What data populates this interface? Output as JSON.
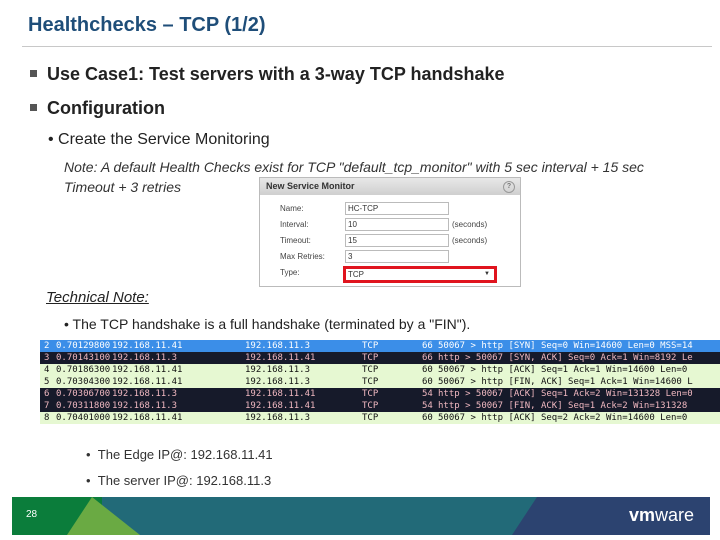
{
  "title": "Healthchecks – TCP (1/2)",
  "bullets": [
    "Use Case1: Test servers with a 3-way TCP handshake",
    "Configuration"
  ],
  "sub_bullet": "Create the Service Monitoring",
  "note": "Note: A default Health Checks exist for TCP \"default_tcp_monitor\" with 5 sec interval + 15 sec Timeout + 3 retries",
  "dialog": {
    "title": "New Service Monitor",
    "help": "?",
    "fields": [
      {
        "label": "Name:",
        "value": "HC-TCP",
        "unit": ""
      },
      {
        "label": "Interval:",
        "value": "10",
        "unit": "(seconds)"
      },
      {
        "label": "Timeout:",
        "value": "15",
        "unit": "(seconds)"
      },
      {
        "label": "Max Retries:",
        "value": "3",
        "unit": ""
      },
      {
        "label": "Type:",
        "value": "TCP",
        "unit": ""
      }
    ]
  },
  "technical_note": "Technical Note:",
  "technical_bullet": "The TCP handshake is a full handshake (terminated by a \"FIN\").",
  "packets": [
    {
      "no": "2",
      "time": "0.70129800",
      "src": "192.168.11.41",
      "dst": "192.168.11.3",
      "proto": "TCP",
      "len": "66",
      "info": "50067 > http [SYN] Seq=0 Win=14600 Len=0 MSS=14",
      "style": "blue"
    },
    {
      "no": "3",
      "time": "0.70143100",
      "src": "192.168.11.3",
      "dst": "192.168.11.41",
      "proto": "TCP",
      "len": "66",
      "info": "http > 50067 [SYN, ACK] Seq=0 Ack=1 Win=8192 Le",
      "style": "dark"
    },
    {
      "no": "4",
      "time": "0.70186300",
      "src": "192.168.11.41",
      "dst": "192.168.11.3",
      "proto": "TCP",
      "len": "60",
      "info": "50067 > http [ACK] Seq=1 Ack=1 Win=14600 Len=0",
      "style": "green"
    },
    {
      "no": "5",
      "time": "0.70304300",
      "src": "192.168.11.41",
      "dst": "192.168.11.3",
      "proto": "TCP",
      "len": "60",
      "info": "50067 > http [FIN, ACK] Seq=1 Ack=1 Win=14600 L",
      "style": "green"
    },
    {
      "no": "6",
      "time": "0.70306700",
      "src": "192.168.11.3",
      "dst": "192.168.11.41",
      "proto": "TCP",
      "len": "54",
      "info": "http > 50067 [ACK] Seq=1 Ack=2 Win=131328 Len=0",
      "style": "dark"
    },
    {
      "no": "7",
      "time": "0.70311800",
      "src": "192.168.11.3",
      "dst": "192.168.11.41",
      "proto": "TCP",
      "len": "54",
      "info": "http > 50067 [FIN, ACK] Seq=1 Ack=2 Win=131328",
      "style": "dark"
    },
    {
      "no": "8",
      "time": "0.70401000",
      "src": "192.168.11.41",
      "dst": "192.168.11.3",
      "proto": "TCP",
      "len": "60",
      "info": "50067 > http [ACK] Seq=2 Ack=2 Win=14600 Len=0",
      "style": "green"
    }
  ],
  "ip_bullets": [
    "The Edge IP@: 192.168.11.41",
    "The server IP@: 192.168.11.3"
  ],
  "footer": {
    "page": "28",
    "logo": "vmware"
  }
}
